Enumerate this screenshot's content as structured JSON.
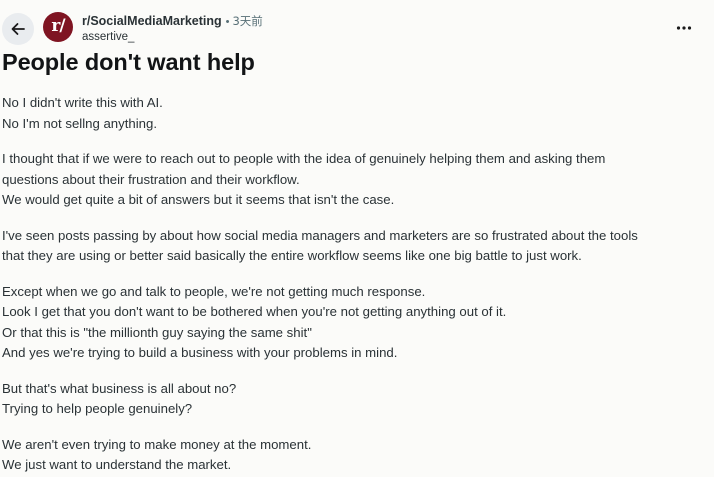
{
  "header": {
    "subreddit": "r/SocialMediaMarketing",
    "separator": "•",
    "time": "3天前",
    "author": "assertive_",
    "avatar_text": "r/"
  },
  "post": {
    "title": "People don't want help",
    "paragraphs": [
      [
        "No I didn't write this with AI.",
        "No I'm not sellng anything."
      ],
      [
        "I thought that if we were to reach out to people with the idea of genuinely helping them and asking them",
        "questions about their frustration and their workflow.",
        "We would get quite a bit of answers but it seems that isn't the case."
      ],
      [
        "I've seen posts passing by about how social media managers and marketers are so frustrated about the tools",
        "that they are using or better said basically the entire workflow seems like one big battle to just work."
      ],
      [
        "Except when we go and talk to people, we're not getting much response.",
        "Look I get that you don't want to be bothered when you're not getting anything out of it.",
        "Or that this is \"the millionth guy saying the same shit\"",
        "And yes we're trying to build a business with your problems in mind."
      ],
      [
        "But that's what business is all about no?",
        "Trying to help people genuinely?"
      ],
      [
        "We aren't even trying to make money at the moment.",
        "We just want to understand the market."
      ]
    ]
  },
  "icons": {
    "back": "arrow-left-icon",
    "more": "more-horizontal-icon"
  },
  "colors": {
    "background": "#fbfbf9",
    "avatar": "#7f1422",
    "back_button_bg": "#e9ecef",
    "text": "#2a3236",
    "meta": "#576f76"
  }
}
